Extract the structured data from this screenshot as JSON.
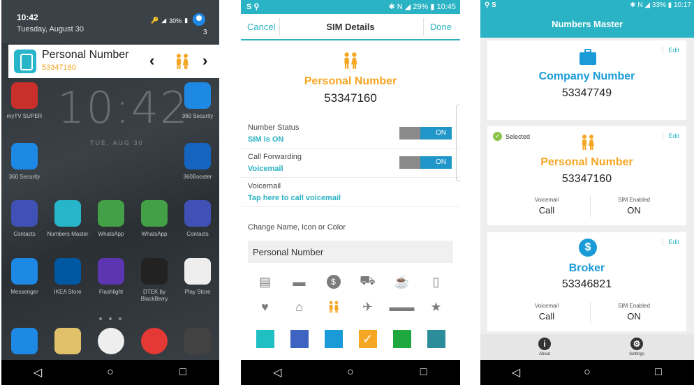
{
  "lockscreen": {
    "time": "10:42",
    "date": "Tuesday, August 30",
    "battery": "30%",
    "avatar_badge": "3",
    "notification": {
      "title": "Personal Number",
      "number": "53347160"
    },
    "big_clock": "10:42",
    "clock_date": "TUE, AUG 30",
    "apps": [
      {
        "label": "myTV SUPER",
        "color": "#c9302c"
      },
      {
        "label": "360 Security",
        "color": "#1e88e5"
      },
      {
        "label": "360 Security",
        "color": "#1e88e5"
      },
      {
        "label": "360Booster",
        "color": "#1565c0"
      },
      {
        "label": "Contacts",
        "color": "#3f51b5"
      },
      {
        "label": "Numbers Master",
        "color": "#26b5c9"
      },
      {
        "label": "WhatsApp",
        "color": "#43a047"
      },
      {
        "label": "WhatsApp",
        "color": "#43a047"
      },
      {
        "label": "Contacts",
        "color": "#3f51b5"
      },
      {
        "label": "Messenger",
        "color": "#1e88e5"
      },
      {
        "label": "IKEA Store",
        "color": "#0058a3"
      },
      {
        "label": "Flashlight",
        "color": "#5e35b1"
      },
      {
        "label": "DTEK by BlackBerry",
        "color": "#222222"
      },
      {
        "label": "Play Store",
        "color": "#eeeeee"
      }
    ]
  },
  "sim_details": {
    "status_time": "10:45",
    "status_battery": "29%",
    "cancel_label": "Cancel",
    "title": "SIM Details",
    "done_label": "Done",
    "name": "Personal Number",
    "number": "53347160",
    "rows": [
      {
        "label": "Number Status",
        "value": "SIM is ON",
        "toggle": "ON"
      },
      {
        "label": "Call Forwarding",
        "value": "Voicemail",
        "toggle": "ON"
      },
      {
        "label": "Voicemail",
        "value": "Tap here to call voicemail",
        "toggle": ""
      }
    ],
    "change_label": "Change Name, Icon or Color",
    "name_input_value": "Personal Number",
    "icons": [
      "document-icon",
      "briefcase-icon",
      "dollar-icon",
      "car-icon",
      "coffee-icon",
      "phone-icon",
      "heart-icon",
      "home-icon",
      "couple-icon",
      "airplane-icon",
      "sunglasses-icon",
      "star-icon"
    ],
    "colors": [
      "#1fbfc4",
      "#3f63c0",
      "#1a9bd7",
      "#f5a623",
      "#1fa83e",
      "#2b8d99"
    ],
    "selected_color_index": 3
  },
  "numbers_master": {
    "status_time": "10:17",
    "status_battery": "33%",
    "title": "Numbers Master",
    "edit_label": "Edit",
    "selected_label": "Selected",
    "cards": [
      {
        "name": "Company Number",
        "number": "53347749",
        "color": "#1a9bd7",
        "icon": "briefcase-icon"
      },
      {
        "name": "Personal Number",
        "number": "53347160",
        "color": "#f5a623",
        "icon": "couple-icon",
        "voicemail_label": "Voicemail",
        "voicemail_value": "Call",
        "sim_label": "SIM Enabled",
        "sim_value": "ON"
      },
      {
        "name": "Broker",
        "number": "53346821",
        "color": "#1a9bd7",
        "icon": "dollar-icon",
        "voicemail_label": "Voicemail",
        "voicemail_value": "Call",
        "sim_label": "SIM Enabled",
        "sim_value": "ON"
      }
    ],
    "tabs": {
      "about": "About",
      "settings": "Settings"
    }
  }
}
